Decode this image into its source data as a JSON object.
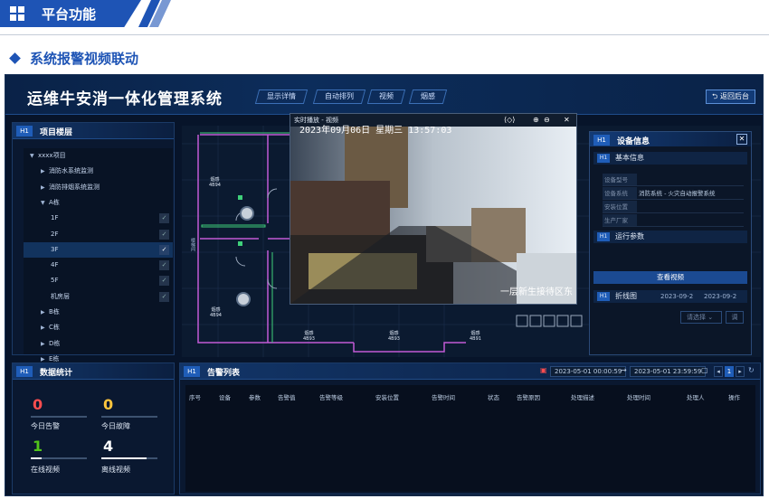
{
  "banner": {
    "title": "平台功能"
  },
  "section": {
    "title": "系统报警视频联动"
  },
  "app": {
    "title": "运维牛安消一体化管理系统",
    "tabs": [
      "显示详情",
      "自动排列",
      "视频",
      "烟感"
    ],
    "back_label": "返回后台"
  },
  "project_panel": {
    "tag": "H1",
    "title": "项目楼层",
    "tree": [
      {
        "label": "xxxx项目",
        "level": 0,
        "caret": "▼"
      },
      {
        "label": "消防水系统监测",
        "level": 1,
        "caret": "▶"
      },
      {
        "label": "消防排烟系统监测",
        "level": 1,
        "caret": "▶"
      },
      {
        "label": "A栋",
        "level": 1,
        "caret": "▼"
      },
      {
        "label": "1F",
        "level": 2,
        "check": true
      },
      {
        "label": "2F",
        "level": 2,
        "check": true
      },
      {
        "label": "3F",
        "level": 2,
        "check": true,
        "selected": true
      },
      {
        "label": "4F",
        "level": 2,
        "check": true
      },
      {
        "label": "5F",
        "level": 2,
        "check": true
      },
      {
        "label": "机房层",
        "level": 2,
        "check": true
      },
      {
        "label": "B栋",
        "level": 1,
        "caret": "▶"
      },
      {
        "label": "C栋",
        "level": 1,
        "caret": "▶"
      },
      {
        "label": "D栋",
        "level": 1,
        "caret": "▶"
      },
      {
        "label": "E栋",
        "level": 1,
        "caret": "▶"
      }
    ]
  },
  "stats_panel": {
    "tag": "H1",
    "title": "数据统计",
    "items": [
      {
        "value": "0",
        "label": "今日告警",
        "color": "#ff4d4f",
        "fill": 0.0
      },
      {
        "value": "0",
        "label": "今日故障",
        "color": "#ffc53d",
        "fill": 0.0
      },
      {
        "value": "1",
        "label": "在线视频",
        "color": "#52c41a",
        "fill": 0.2
      },
      {
        "value": "4",
        "label": "离线视频",
        "color": "#ffffff",
        "fill": 0.8
      }
    ]
  },
  "video": {
    "title": "实时播放 - 视频",
    "osd_time": "2023年09月06日 星期三 13:57:03",
    "osd_location": "一层新生接待区东"
  },
  "device_panel": {
    "tag": "H1",
    "title": "设备信息",
    "section_basic": "基本信息",
    "rows": [
      {
        "key": "设备型号",
        "value": ""
      },
      {
        "key": "设备系统",
        "value": "消防系统 - 火灾自动报警系统"
      },
      {
        "key": "安装位置",
        "value": ""
      },
      {
        "key": "生产厂家",
        "value": ""
      }
    ],
    "section_params": "运行参数",
    "view_video_label": "查看视频",
    "chart_section": "折线图",
    "date_from": "2023-09-2",
    "date_to": "2023-09-2",
    "select_placeholder": "请选择",
    "query_label": "调"
  },
  "floor_labels": [
    {
      "name": "烟感",
      "code": "4B94"
    },
    {
      "name": "烟感",
      "code": "4B94"
    },
    {
      "name": "烟感",
      "code": "4B93"
    },
    {
      "name": "烟感",
      "code": "4B93"
    },
    {
      "name": "烟感",
      "code": "4B91"
    }
  ],
  "floor_side_label": "楼梯间",
  "alarm_panel": {
    "tag": "H1",
    "title": "告警列表",
    "date_start": "2023-05-01 00:00:59",
    "date_end": "2023-05-01 23:59:59",
    "range_sep": "→",
    "page": "1",
    "columns": [
      "序号",
      "设备",
      "参数",
      "告警值",
      "告警等级",
      "安装位置",
      "告警时间",
      "状态",
      "告警原因",
      "处理描述",
      "处理时间",
      "处理人",
      "操作"
    ]
  },
  "colors": {
    "accent": "#1e54b5",
    "screen_bg": "#07142a"
  }
}
